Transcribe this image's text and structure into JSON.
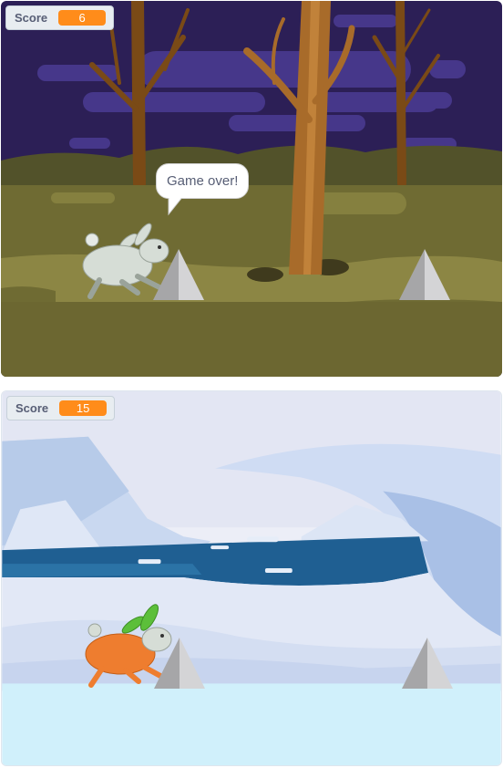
{
  "stage_forest": {
    "score_label": "Score",
    "score_value": "6",
    "speech_bubble": "Game over!"
  },
  "stage_arctic": {
    "score_label": "Score",
    "score_value": "15"
  }
}
